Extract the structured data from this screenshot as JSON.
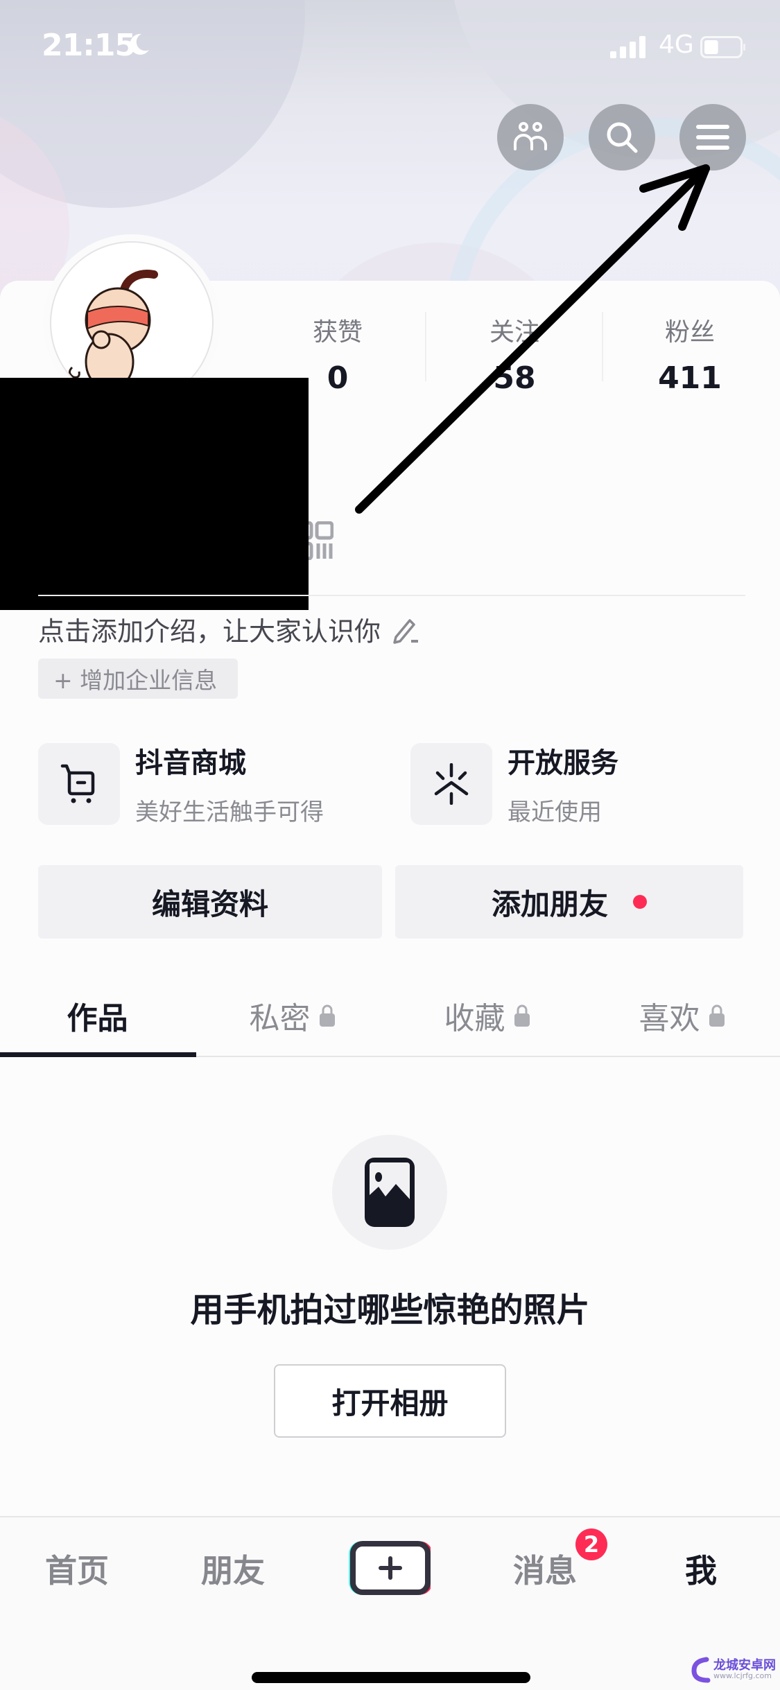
{
  "status_bar": {
    "time": "21:15",
    "network": "4G",
    "battery_level": 0.4,
    "icons": [
      "moon-icon",
      "signal-icon",
      "battery-icon"
    ]
  },
  "header_actions": [
    {
      "name": "friends",
      "icon": "friends-icon"
    },
    {
      "name": "search",
      "icon": "search-icon"
    },
    {
      "name": "menu",
      "icon": "hamburger-menu-icon"
    }
  ],
  "profile": {
    "stats": [
      {
        "label": "获赞",
        "value": "0"
      },
      {
        "label": "关注",
        "value": "58"
      },
      {
        "label": "粉丝",
        "value": "411"
      }
    ],
    "bio_placeholder": "点击添加介绍，让大家认识你",
    "enterprise_chip": "+ 增加企业信息"
  },
  "services": [
    {
      "icon": "shopping-cart-icon",
      "title": "抖音商城",
      "subtitle": "美好生活触手可得"
    },
    {
      "icon": "open-services-icon",
      "title": "开放服务",
      "subtitle": "最近使用"
    }
  ],
  "actions": {
    "edit_profile": "编辑资料",
    "add_friends": "添加朋友"
  },
  "tabs": [
    {
      "label": "作品",
      "active": true,
      "locked": false
    },
    {
      "label": "私密",
      "active": false,
      "locked": true
    },
    {
      "label": "收藏",
      "active": false,
      "locked": true
    },
    {
      "label": "喜欢",
      "active": false,
      "locked": true
    }
  ],
  "empty_state": {
    "icon": "image-icon",
    "message": "用手机拍过哪些惊艳的照片",
    "button": "打开相册"
  },
  "bottom_nav": {
    "items": [
      {
        "label": "首页",
        "active": false
      },
      {
        "label": "朋友",
        "active": false
      },
      {
        "label": "+",
        "active": false
      },
      {
        "label": "消息",
        "active": false,
        "badge": "2"
      },
      {
        "label": "我",
        "active": true
      }
    ]
  },
  "watermark": {
    "name": "龙城安卓网",
    "url": "www.lcjrfg.com"
  },
  "colors": {
    "accent": "#fe2c55",
    "text_primary": "#161823",
    "text_secondary": "#8a8b91"
  }
}
